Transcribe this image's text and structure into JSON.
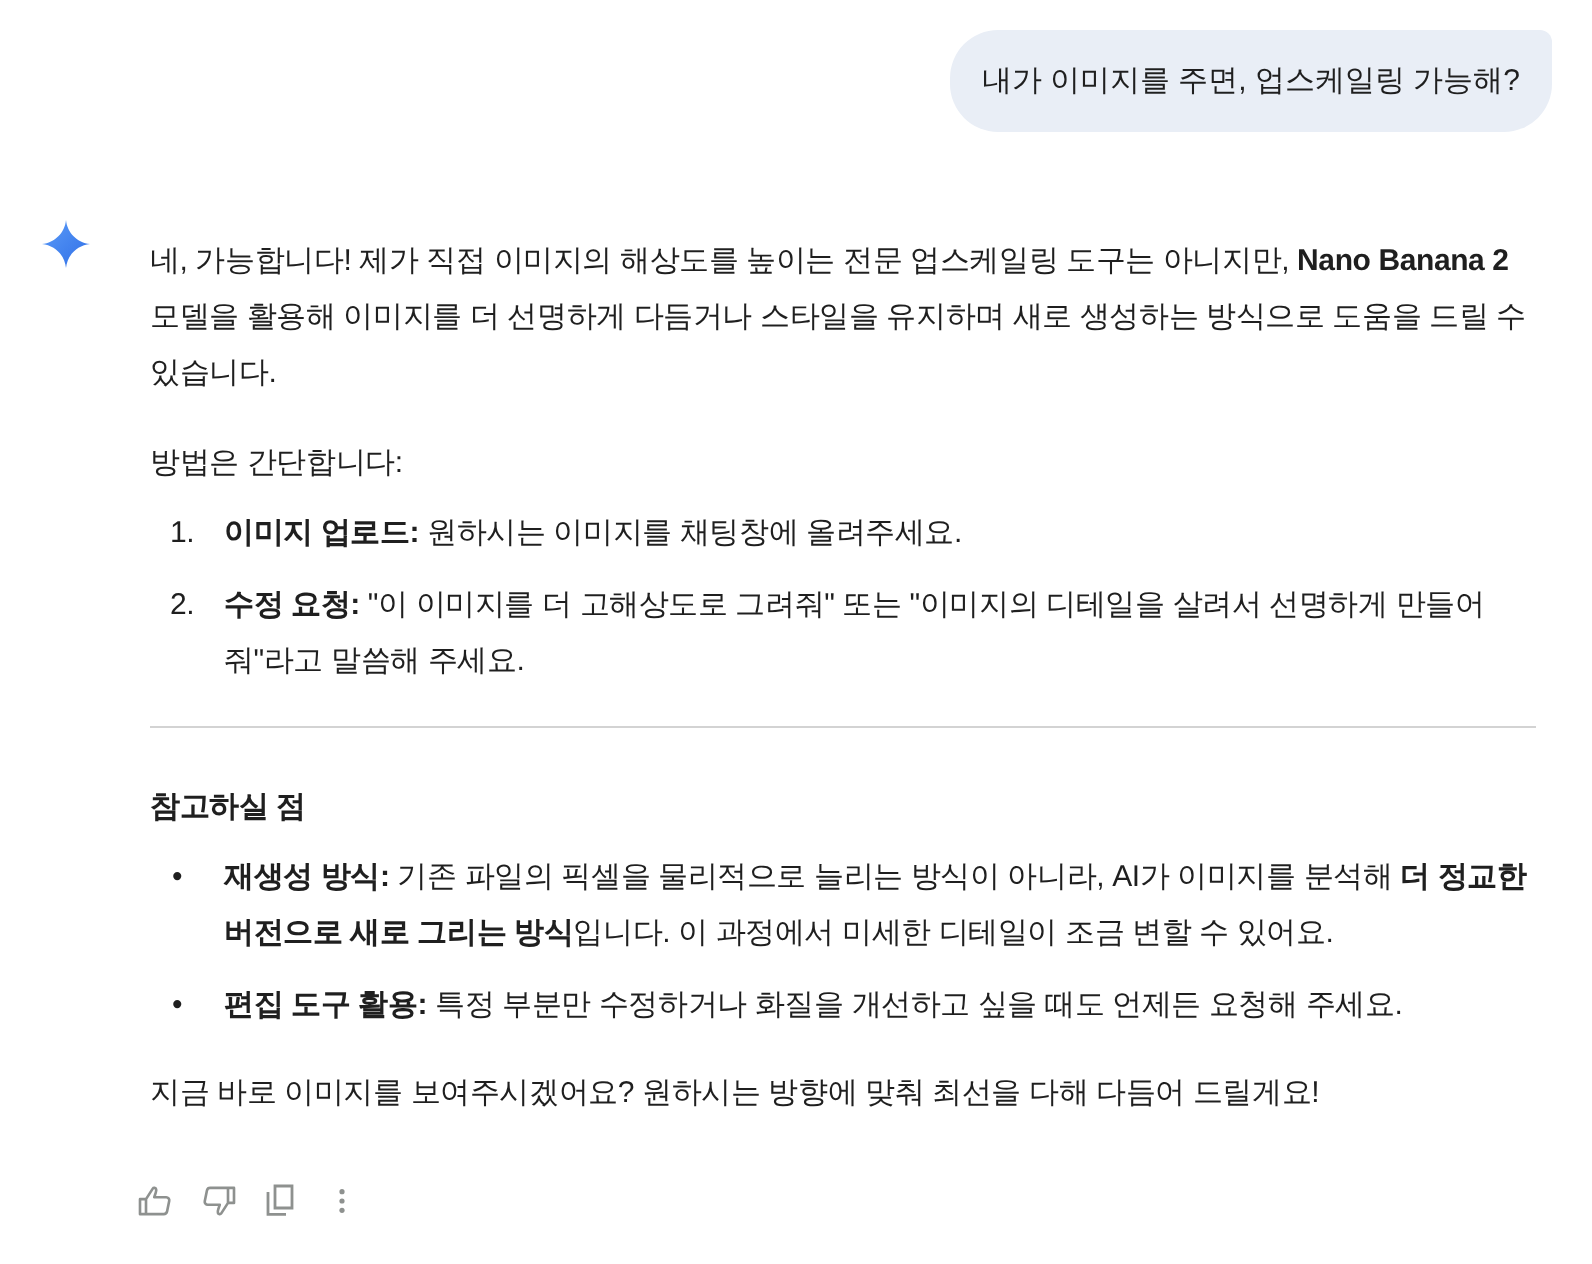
{
  "user_message": {
    "text": "내가 이미지를 주면, 업스케일링 가능해?"
  },
  "response": {
    "blocks": [
      {
        "kind": "paragraph",
        "text": "네, 가능합니다! 제가 직접 이미지의 해상도를 높이는 전문 업스케일링 도구는 아니지만, **Nano Banana 2** 모델을 활용해 이미지를 더 선명하게 다듬거나 스타일을 유지하며 새로 생성하는 방식으로 도움을 드릴 수 있습니다."
      },
      {
        "kind": "paragraph",
        "text": "방법은 간단합니다:"
      },
      {
        "kind": "ordered_list",
        "items": [
          {
            "marker": "1.",
            "text": "**이미지 업로드:** 원하시는 이미지를 채팅창에 올려주세요."
          },
          {
            "marker": "2.",
            "text": "**수정 요청:** \"이 이미지를 더 고해상도로 그려줘\" 또는 \"이미지의 디테일을 살려서 선명하게 만들어 줘\"라고 말씀해 주세요."
          }
        ]
      },
      {
        "kind": "divider"
      },
      {
        "kind": "heading",
        "text": "참고하실 점"
      },
      {
        "kind": "bullet_list",
        "items": [
          {
            "marker": "•",
            "text": "**재생성 방식:** 기존 파일의 픽셀을 물리적으로 늘리는 방식이 아니라, AI가 이미지를 분석해 **더 정교한 버전으로 새로 그리는 방식**입니다. 이 과정에서 미세한 디테일이 조금 변할 수 있어요."
          },
          {
            "marker": "•",
            "text": "**편집 도구 활용:** 특정 부분만 수정하거나 화질을 개선하고 싶을 때도 언제든 요청해 주세요."
          }
        ]
      },
      {
        "kind": "paragraph",
        "text": "지금 바로 이미지를 보여주시겠어요? 원하시는 방향에 맞춰 최선을 다해 다듬어 드릴게요!"
      }
    ]
  }
}
